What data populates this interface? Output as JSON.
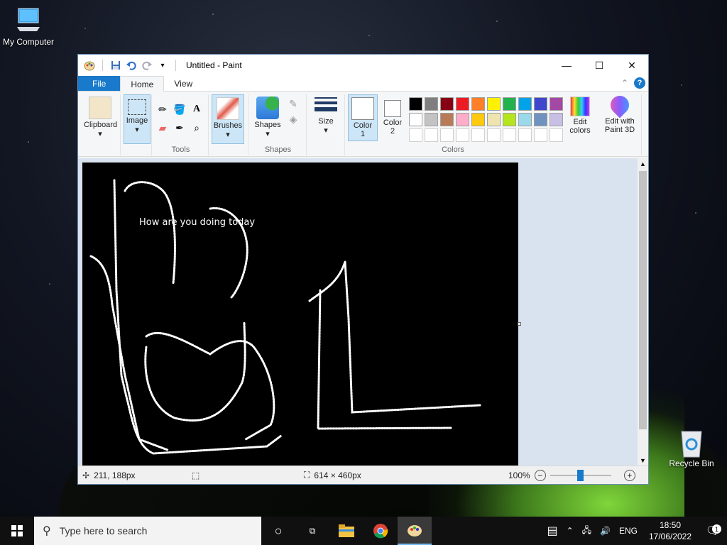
{
  "desktop": {
    "icons": [
      {
        "label": "My Computer"
      },
      {
        "label": "Recycle Bin"
      }
    ]
  },
  "window": {
    "title": "Untitled - Paint",
    "tabs": {
      "file": "File",
      "home": "Home",
      "view": "View"
    },
    "ribbon": {
      "clipboard": "Clipboard",
      "image": "Image",
      "tools_group": "Tools",
      "brushes": "Brushes",
      "shapes": "Shapes",
      "shapes_group": "Shapes",
      "size": "Size",
      "color1_line1": "Color",
      "color1_line2": "1",
      "color2_line1": "Color",
      "color2_line2": "2",
      "colors_group": "Colors",
      "edit_colors_line1": "Edit",
      "edit_colors_line2": "colors",
      "paint3d_line1": "Edit with",
      "paint3d_line2": "Paint 3D"
    },
    "palette_row1": [
      "#000000",
      "#7f7f7f",
      "#880015",
      "#ed1c24",
      "#ff7f27",
      "#fff200",
      "#22b14c",
      "#00a2e8",
      "#3f48cc",
      "#a349a4"
    ],
    "palette_row2": [
      "#ffffff",
      "#c3c3c3",
      "#b97a57",
      "#ffaec9",
      "#ffc90e",
      "#efe4b0",
      "#b5e61d",
      "#99d9ea",
      "#7092be",
      "#c8bfe7"
    ],
    "canvas": {
      "text": "How are you doing today"
    },
    "status": {
      "cursor_pos": "211, 188px",
      "canvas_size": "614 × 460px",
      "zoom": "100%"
    }
  },
  "taskbar": {
    "search_placeholder": "Type here to search",
    "lang": "ENG",
    "time": "18:50",
    "date": "17/06/2022",
    "notification_count": "1"
  },
  "colors": {
    "accent": "#1979ca",
    "selected": "#cde6f7"
  }
}
